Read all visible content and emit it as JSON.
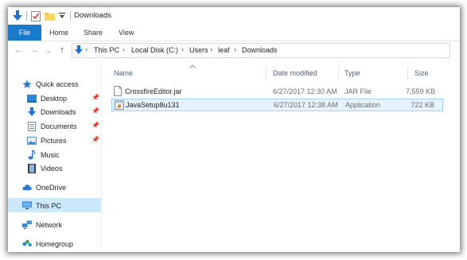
{
  "window": {
    "title": "Downloads"
  },
  "ribbon": {
    "tabs": [
      "File",
      "Home",
      "Share",
      "View"
    ]
  },
  "nav": {
    "back": "←",
    "forward": "→",
    "dropdown": "⌄",
    "up": "↑"
  },
  "address": {
    "crumbs": [
      "This PC",
      "Local Disk (C:)",
      "Users",
      "leaf",
      "Downloads"
    ],
    "sep": "›"
  },
  "sidebar": {
    "quick_access": "Quick access",
    "pinned": [
      "Desktop",
      "Downloads",
      "Documents",
      "Pictures"
    ],
    "others": [
      "Music",
      "Videos"
    ],
    "onedrive": "OneDrive",
    "thispc": "This PC",
    "network": "Network",
    "homegroup": "Homegroup"
  },
  "columns": {
    "name": "Name",
    "date": "Date modified",
    "type": "Type",
    "size": "Size"
  },
  "files": [
    {
      "name": "CrossfireEditor.jar",
      "date": "6/27/2017 12:30 AM",
      "type": "JAR File",
      "size": "7,559 KB"
    },
    {
      "name": "JavaSetup8u131",
      "date": "6/27/2017 12:38 AM",
      "type": "Application",
      "size": "722 KB"
    }
  ],
  "colors": {
    "accent": "#1979ca",
    "selection": "#cce8ff",
    "row_selected": "#e5f3ff"
  }
}
